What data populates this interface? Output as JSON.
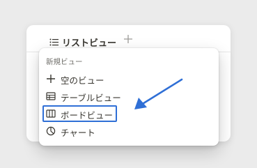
{
  "tab": {
    "icon": "list-icon",
    "label": "リストビュー",
    "add_icon": "plus-icon"
  },
  "menu": {
    "header": "新規ビュー",
    "items": [
      {
        "icon": "plus-icon",
        "label": "空のビュー"
      },
      {
        "icon": "table-icon",
        "label": "テーブルビュー"
      },
      {
        "icon": "board-icon",
        "label": "ボードビュー"
      },
      {
        "icon": "chart-icon",
        "label": "チャート"
      }
    ]
  },
  "annotation": {
    "highlight_color": "#2f6fd6",
    "arrow_color": "#2f6fd6"
  }
}
